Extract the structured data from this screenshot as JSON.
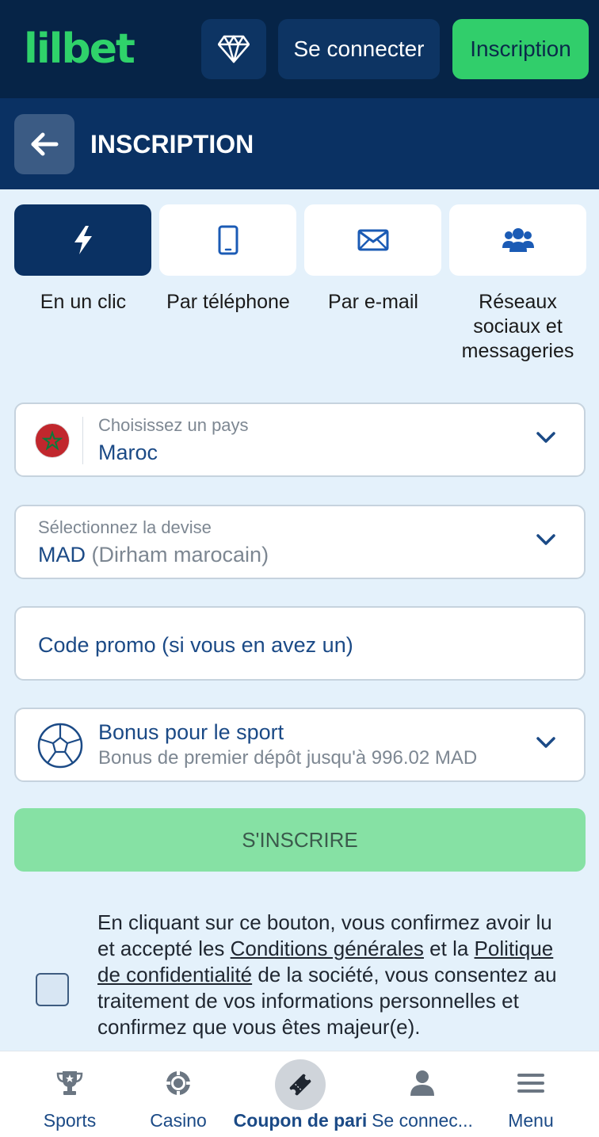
{
  "header": {
    "logo": "lilbet",
    "diamond_icon": "diamond-icon",
    "login_label": "Se connecter",
    "register_label": "Inscription"
  },
  "subheader": {
    "back_icon": "arrow-left-icon",
    "title": "INSCRIPTION"
  },
  "methods": [
    {
      "label": "En un clic",
      "icon": "lightning-icon",
      "active": true
    },
    {
      "label": "Par téléphone",
      "icon": "phone-icon",
      "active": false
    },
    {
      "label": "Par e-mail",
      "icon": "envelope-icon",
      "active": false
    },
    {
      "label": "Réseaux sociaux et messageries",
      "icon": "users-icon",
      "active": false
    }
  ],
  "form": {
    "country": {
      "label": "Choisissez un pays",
      "value": "Maroc",
      "flag": "morocco-flag"
    },
    "currency": {
      "label": "Sélectionnez la devise",
      "code": "MAD",
      "name": "(Dirham marocain)"
    },
    "promo": {
      "placeholder": "Code promo (si vous en avez un)"
    },
    "bonus": {
      "title": "Bonus pour le sport",
      "subtitle": "Bonus de premier dépôt jusqu'à 996.02 MAD",
      "icon": "soccer-ball-icon"
    },
    "submit_label": "S'INSCRIRE"
  },
  "terms": {
    "part1": "En cliquant sur ce bouton, vous confirmez avoir lu et accepté les ",
    "link1": "Conditions générales",
    "part2": " et la ",
    "link2": "Politique de confidentialité",
    "part3": " de la société, vous consentez au traitement de vos informations personnelles et confirmez que vous êtes majeur(e)."
  },
  "bottom_nav": [
    {
      "label": "Sports",
      "icon": "trophy-icon"
    },
    {
      "label": "Casino",
      "icon": "casino-chip-icon"
    },
    {
      "label": "Coupon de pari",
      "icon": "ticket-icon"
    },
    {
      "label": "Se connec...",
      "icon": "user-icon"
    },
    {
      "label": "Menu",
      "icon": "hamburger-icon"
    }
  ],
  "colors": {
    "header_bg": "#062447",
    "subheader_bg": "#0a3163",
    "brand_green": "#2fd26a",
    "page_bg": "#e4f1fb",
    "text_blue": "#1b4a86"
  }
}
